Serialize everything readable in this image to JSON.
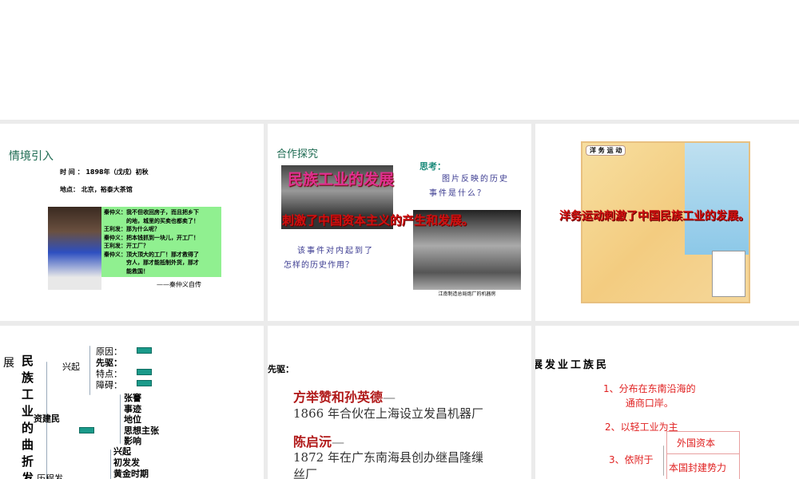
{
  "slides": [
    {
      "title": "情境引入",
      "time": "时 间 ： 1898年（戊戌）初秋",
      "place": "地点： 北京，裕泰大茶馆",
      "dialogue": [
        "秦仲义：我不但收回房子，而且把乡下",
        "　　　　的地，城里的买卖也都卖了！",
        "王利发：那为什么呢？",
        "秦仲义：把本钱抓到一块儿，开工厂！",
        "王利发：开工厂？",
        "秦仲义：顶大顶大的工厂！那才救得了",
        "　　　　穷人，那才能抵制外货，那才",
        "　　　　能救国！"
      ],
      "source": "——秦仲义自传"
    },
    {
      "title": "合作探究",
      "overlay1": "民族工业的发展",
      "think_label": "思考：",
      "think_q": [
        "图片反映的历史",
        "事件是什么？"
      ],
      "overlay2": "刺激了中国资本主义的产生和发展。",
      "q2": [
        "该事件对内起到了",
        "怎样的历史作用？"
      ],
      "caption": "江南制造总局炮厂的机器房"
    },
    {
      "map_title": "洋 务 运 动",
      "overlay": "洋务运动刺激了中国民族工业的发展。"
    },
    {
      "side": "展",
      "vertical": "民族工业的曲折发",
      "branch1": "兴起",
      "items1": [
        "原因：",
        "先驱：",
        "特点：",
        "障碍："
      ],
      "branch2": "资建民",
      "items2": [
        "张謇",
        "事迹",
        "地位",
        "思想主张",
        "影响"
      ],
      "branch3": "历程发",
      "items3": [
        "兴起",
        "初发发",
        "黄金时期"
      ]
    },
    {
      "heading": "先驱：",
      "p1_name": "方举赞和孙英德",
      "dash": "—",
      "p1_text": "1866 年合伙在上海设立发昌机器厂",
      "p2_name": "陈启沅",
      "p2_text": [
        "1872 年在广东南海县创办继昌隆缫",
        "丝厂"
      ]
    },
    {
      "heading": "展发业工族民",
      "point1": [
        "1、分布在东南沿海的",
        "通商口岸。"
      ],
      "point2": "2、以轻工业为主",
      "point3": "3、依附于",
      "box": [
        "外国资本",
        "本国封建势力"
      ]
    }
  ]
}
